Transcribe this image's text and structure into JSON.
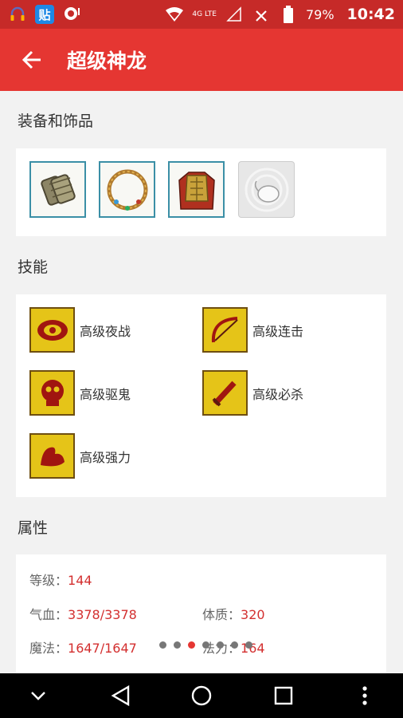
{
  "status_bar": {
    "badge_text": "贴",
    "network_label": "4G LTE",
    "battery": "79%",
    "time": "10:42"
  },
  "app_bar": {
    "title": "超级神龙"
  },
  "equipment": {
    "heading": "装备和饰品",
    "items": [
      {
        "name": "bracer-icon"
      },
      {
        "name": "necklace-icon"
      },
      {
        "name": "armor-icon"
      },
      {
        "name": "empty-slot-icon"
      }
    ]
  },
  "skills": {
    "heading": "技能",
    "items": [
      {
        "label": "高级夜战",
        "icon": "night-battle-skill-icon"
      },
      {
        "label": "高级连击",
        "icon": "combo-skill-icon"
      },
      {
        "label": "高级驱鬼",
        "icon": "exorcise-skill-icon"
      },
      {
        "label": "高级必杀",
        "icon": "critical-skill-icon"
      },
      {
        "label": "高级强力",
        "icon": "strength-skill-icon"
      }
    ]
  },
  "attributes": {
    "heading": "属性",
    "level_label": "等级：",
    "level_value": "144",
    "hp_label": "气血：",
    "hp_value": "3378/3378",
    "constitution_label": "体质：",
    "constitution_value": "320",
    "mp_label": "魔法：",
    "mp_value": "1647/1647",
    "magic_label": "法力：",
    "magic_value": "164"
  },
  "pager": {
    "count": 7,
    "active_index": 2
  },
  "colors": {
    "status_bar": "#c62a28",
    "app_bar": "#e53632",
    "value_red": "#d32f2f",
    "skill_gold": "#e5c418"
  }
}
